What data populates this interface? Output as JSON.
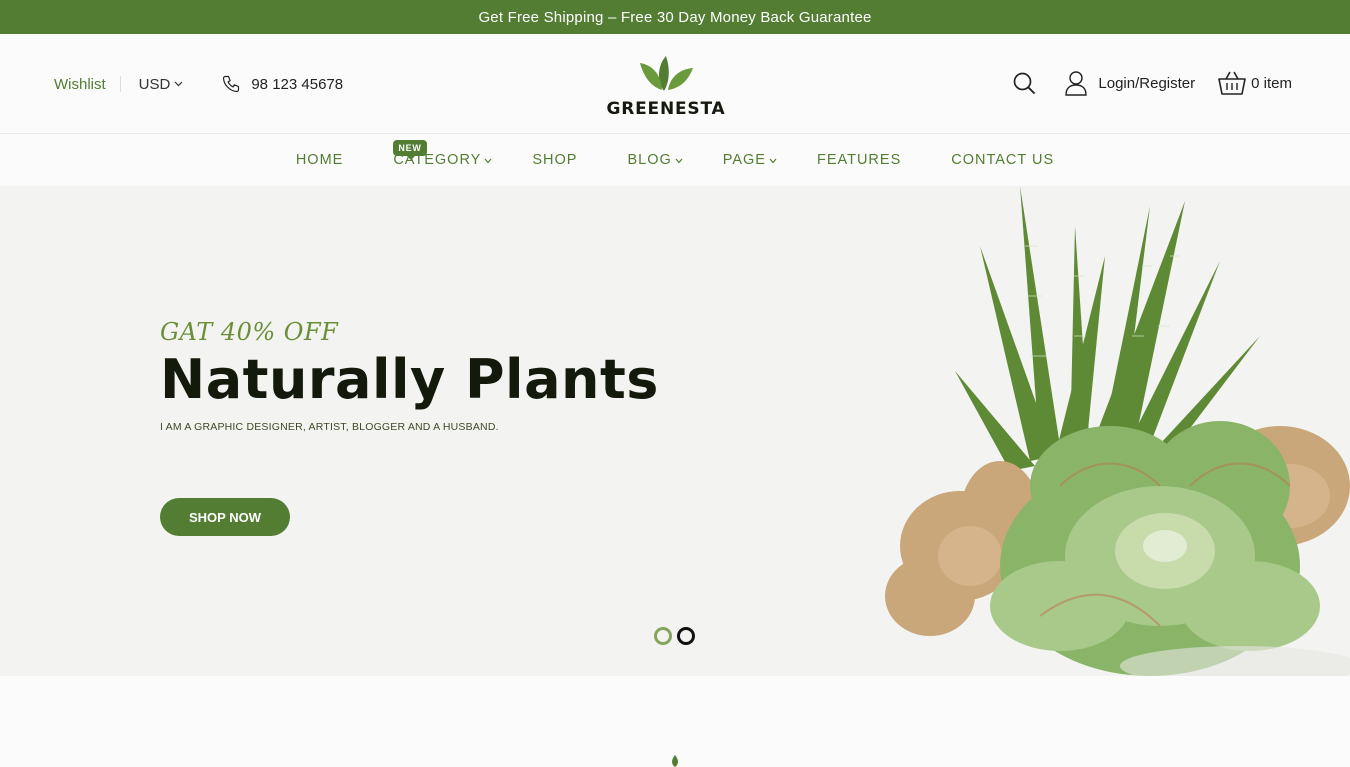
{
  "topbar": {
    "text": "Get Free Shipping – Free 30 Day Money Back Guarantee"
  },
  "header": {
    "wishlist": "Wishlist",
    "currency": "USD",
    "phone": "98 123 45678",
    "logo_text": "GREENESTA",
    "login": "Login/Register",
    "cart": "0 item"
  },
  "nav": {
    "items": [
      {
        "label": "HOME"
      },
      {
        "label": "CATEGORY",
        "badge": "NEW"
      },
      {
        "label": "SHOP"
      },
      {
        "label": "BLOG"
      },
      {
        "label": "PAGE"
      },
      {
        "label": "FEATURES"
      },
      {
        "label": "CONTACT US"
      }
    ]
  },
  "hero": {
    "promo": "GAT 40% OFF",
    "title": "Naturally Plants",
    "subtitle": "I AM A GRAPHIC DESIGNER, ARTIST, BLOGGER AND A HUSBAND.",
    "button": "SHOP NOW",
    "slides": 2,
    "active_slide": 1
  },
  "colors": {
    "brand": "#527d33",
    "dark": "#131a0c"
  }
}
